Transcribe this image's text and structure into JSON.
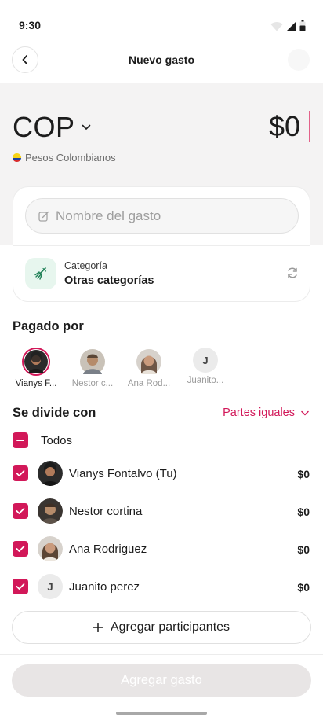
{
  "status": {
    "time": "9:30"
  },
  "header": {
    "title": "Nuevo gasto"
  },
  "currency": {
    "code": "COP",
    "name": "Pesos Colombianos",
    "amount": "$0"
  },
  "form": {
    "name_placeholder": "Nombre del gasto",
    "category_label": "Categoría",
    "category_value": "Otras categorías"
  },
  "paid_by": {
    "title": "Pagado por",
    "people": [
      {
        "name": "Vianys F...",
        "selected": true
      },
      {
        "name": "Nestor c...",
        "selected": false
      },
      {
        "name": "Ana Rod...",
        "selected": false
      },
      {
        "name": "Juanito...",
        "initial": "J",
        "selected": false
      }
    ]
  },
  "split": {
    "title": "Se divide con",
    "mode": "Partes iguales",
    "all_label": "Todos",
    "participants": [
      {
        "name": "Vianys Fontalvo (Tu)",
        "amount": "$0",
        "checked": true
      },
      {
        "name": "Nestor cortina",
        "amount": "$0",
        "checked": true
      },
      {
        "name": "Ana Rodriguez",
        "amount": "$0",
        "checked": true
      },
      {
        "name": "Juanito perez",
        "initial": "J",
        "amount": "$0",
        "checked": true
      }
    ],
    "add_label": "Agregar participantes"
  },
  "submit": {
    "label": "Agregar gasto"
  },
  "colors": {
    "accent": "#d21859",
    "category_bg": "#e7f6ee",
    "band": "#f4f3f3"
  }
}
